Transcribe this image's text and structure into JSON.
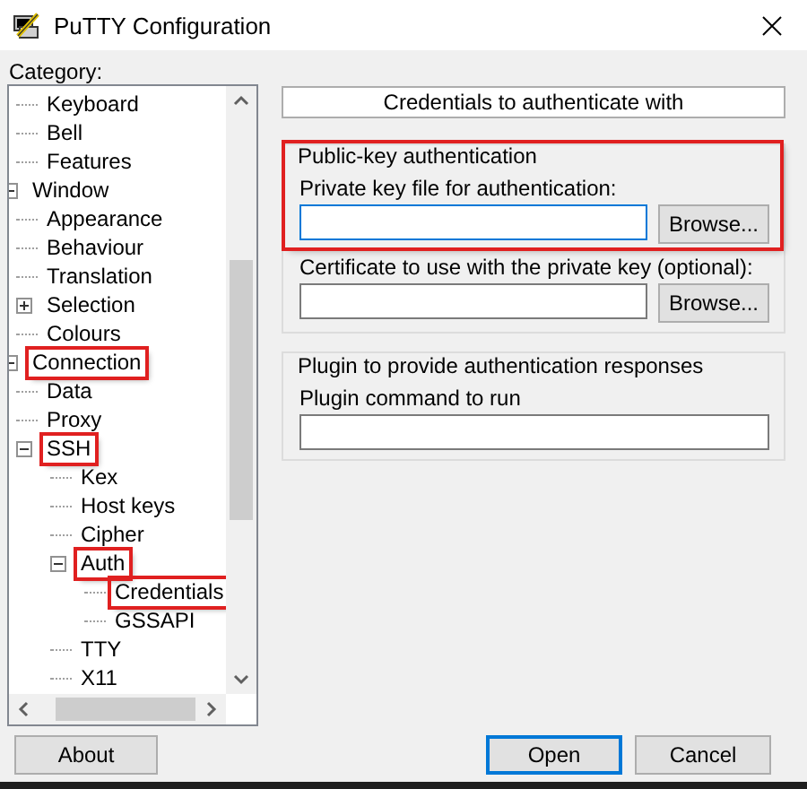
{
  "window": {
    "title": "PuTTY Configuration"
  },
  "category": {
    "label": "Category:",
    "tree": [
      {
        "children": [
          {
            "label": "Keyboard",
            "annotated": false
          },
          {
            "label": "Bell",
            "annotated": false
          },
          {
            "label": "Features",
            "annotated": false
          }
        ]
      },
      {
        "label": "Window",
        "annotated": false,
        "expanded": true,
        "children": [
          {
            "label": "Appearance",
            "annotated": false
          },
          {
            "label": "Behaviour",
            "annotated": false
          },
          {
            "label": "Translation",
            "annotated": false
          },
          {
            "label": "Selection",
            "annotated": false,
            "expanded": false
          },
          {
            "label": "Colours",
            "annotated": false
          }
        ]
      },
      {
        "label": "Connection",
        "annotated": true,
        "expanded": true,
        "children": [
          {
            "label": "Data",
            "annotated": false
          },
          {
            "label": "Proxy",
            "annotated": false
          },
          {
            "label": "SSH",
            "annotated": true,
            "expanded": true,
            "children": [
              {
                "label": "Kex",
                "annotated": false
              },
              {
                "label": "Host keys",
                "annotated": false
              },
              {
                "label": "Cipher",
                "annotated": false
              },
              {
                "label": "Auth",
                "annotated": true,
                "expanded": true,
                "children": [
                  {
                    "label": "Credentials",
                    "annotated": true
                  },
                  {
                    "label": "GSSAPI",
                    "annotated": false
                  }
                ]
              },
              {
                "label": "TTY",
                "annotated": false
              },
              {
                "label": "X11",
                "annotated": false
              }
            ]
          }
        ]
      }
    ]
  },
  "panel": {
    "header": "Credentials to authenticate with",
    "groups": [
      {
        "title": "Public-key authentication",
        "annotated": true,
        "fields": [
          {
            "label": "Private key file for authentication:",
            "button": "Browse...",
            "focused": true
          },
          {
            "label": "Certificate to use with the private key (optional):",
            "button": "Browse...",
            "focused": false
          }
        ]
      },
      {
        "title": "Plugin to provide authentication responses",
        "annotated": false,
        "fields": [
          {
            "label": "Plugin command to run",
            "focused": false
          }
        ]
      }
    ]
  },
  "buttons": [
    {
      "label": "About",
      "default": false
    },
    {
      "label": "Open",
      "default": true
    },
    {
      "label": "Cancel",
      "default": false
    }
  ]
}
